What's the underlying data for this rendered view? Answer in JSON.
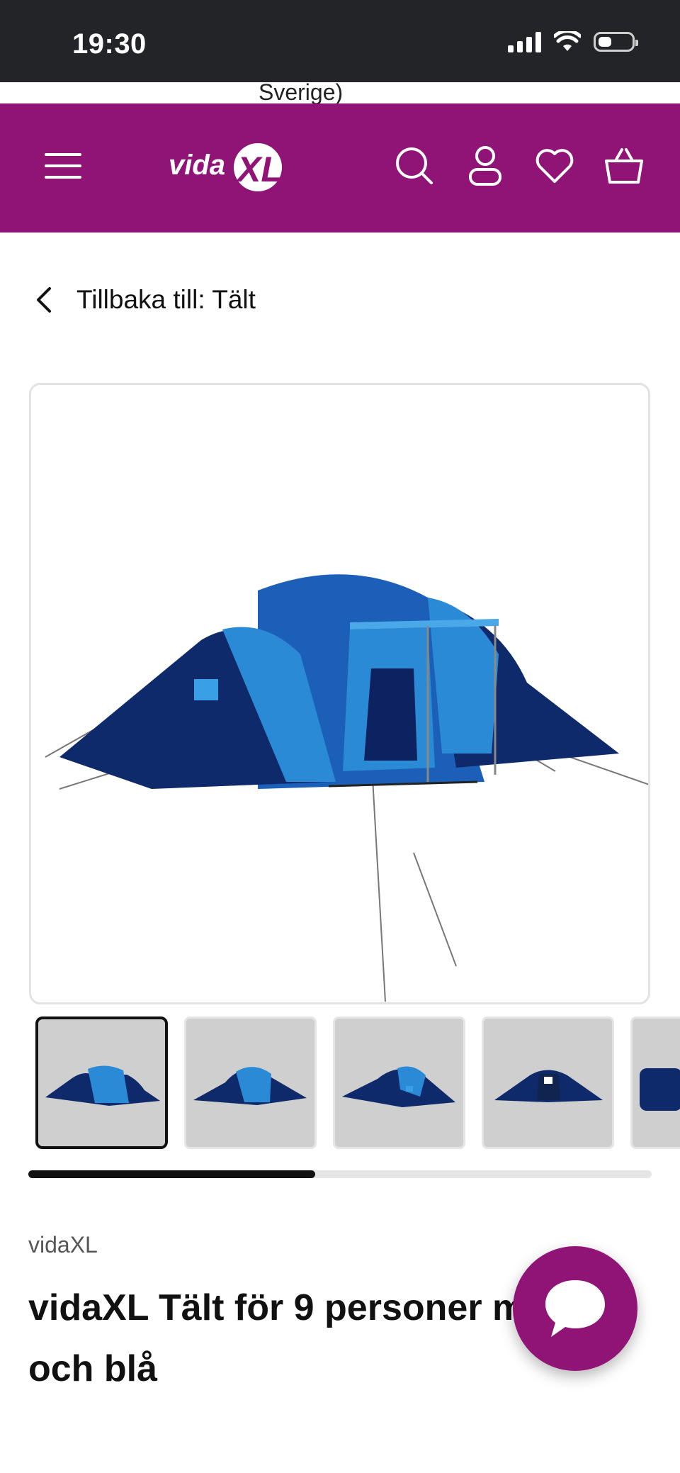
{
  "status_bar": {
    "time": "19:30"
  },
  "url_strip": {
    "text": "Sverige)"
  },
  "header": {
    "logo_text": "vidaXL"
  },
  "back": {
    "label": "Tillbaka till: Tält"
  },
  "gallery": {
    "thumbnail_count": 5,
    "active_index": 0,
    "scroll_progress": 0.46
  },
  "product": {
    "brand": "vidaXL",
    "title": "vidaXL Tält för 9 personer mörkblå och blå"
  },
  "colors": {
    "brand_purple": "#901476",
    "status_bar": "#232428",
    "tent_dark": "#0f2a6b",
    "tent_light": "#2a8ad6"
  }
}
